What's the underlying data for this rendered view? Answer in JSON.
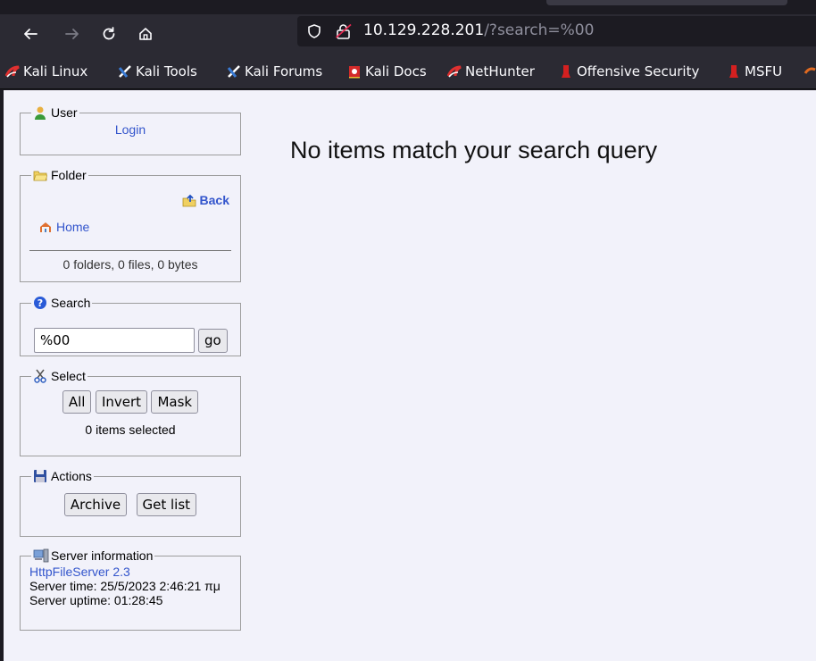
{
  "browser": {
    "url_host": "10.129.228.201",
    "url_path": "/?search=%00",
    "bookmarks": [
      {
        "label": "Kali Linux",
        "icon": "kali-dragon-icon"
      },
      {
        "label": "Kali Tools",
        "icon": "kali-tools-icon"
      },
      {
        "label": "Kali Forums",
        "icon": "kali-forums-icon"
      },
      {
        "label": "Kali Docs",
        "icon": "kali-docs-icon"
      },
      {
        "label": "NetHunter",
        "icon": "nethunter-icon"
      },
      {
        "label": "Offensive Security",
        "icon": "offsec-icon"
      },
      {
        "label": "MSFU",
        "icon": "msfu-icon"
      }
    ]
  },
  "sidebar": {
    "user": {
      "legend": "User",
      "login": "Login"
    },
    "folder": {
      "legend": "Folder",
      "back": "Back",
      "home": "Home",
      "summary": "0 folders, 0 files, 0 bytes"
    },
    "search": {
      "legend": "Search",
      "value": "%00",
      "go": "go"
    },
    "select": {
      "legend": "Select",
      "all": "All",
      "invert": "Invert",
      "mask": "Mask",
      "status": "0 items selected"
    },
    "actions": {
      "legend": "Actions",
      "archive": "Archive",
      "get_list": "Get list"
    },
    "server": {
      "legend": "Server information",
      "software": "HttpFileServer 2.3",
      "time": "Server time: 25/5/2023 2:46:21 πμ",
      "uptime": "Server uptime: 01:28:45"
    }
  },
  "main": {
    "message": "No items match your search query"
  },
  "colors": {
    "link": "#3355cc",
    "chrome": "#2b2a33",
    "page_bg": "#f2f2fa"
  }
}
